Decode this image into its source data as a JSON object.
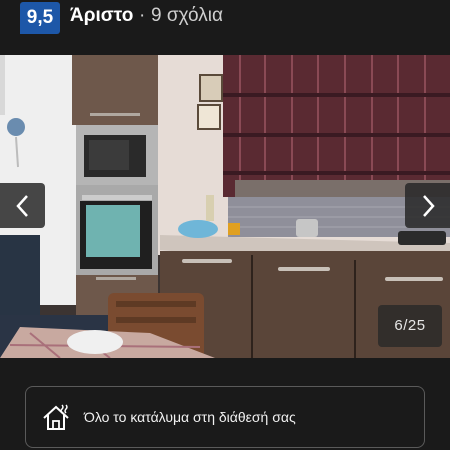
{
  "header": {
    "score": "9,5",
    "rating_label": "Άριστο",
    "separator": "·",
    "reviews": "9 σχόλια"
  },
  "gallery": {
    "counter": "6/25",
    "prev_icon": "chevron-left-icon",
    "next_icon": "chevron-right-icon"
  },
  "amenity": {
    "icon": "house-with-heat-icon",
    "label": "Όλο το κατάλυμα στη διάθεσή σας"
  },
  "colors": {
    "background": "#1a1a1a",
    "score_badge": "#1d57a8"
  }
}
